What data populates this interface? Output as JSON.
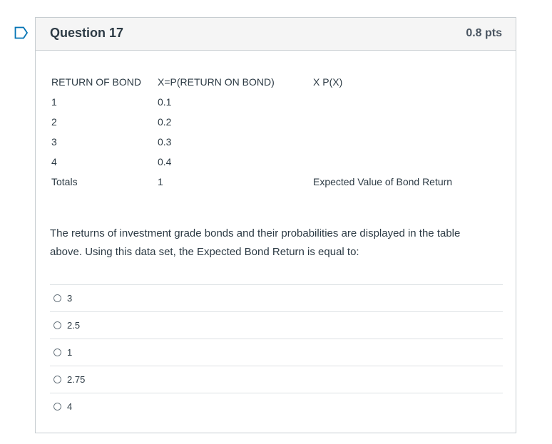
{
  "question": {
    "title": "Question 17",
    "points": "0.8 pts"
  },
  "table": {
    "headers": [
      "RETURN OF BOND",
      "X=P(RETURN ON BOND)",
      "X P(X)"
    ],
    "rows": [
      [
        "1",
        "0.1",
        ""
      ],
      [
        "2",
        "0.2",
        ""
      ],
      [
        "3",
        "0.3",
        ""
      ],
      [
        "4",
        "0.4",
        ""
      ],
      [
        "Totals",
        "1",
        "Expected Value of Bond Return"
      ]
    ]
  },
  "prompt": "The returns of investment grade bonds and their probabilities are displayed in the table above. Using this data set, the Expected Bond Return is equal to:",
  "answers": [
    "3",
    "2.5",
    "1",
    "2.75",
    "4"
  ],
  "colors": {
    "flag": "#0374b5",
    "border": "#c7cdd1",
    "header_bg": "#f5f5f5"
  },
  "icons": {
    "flag": "bookmark-flag-icon"
  }
}
